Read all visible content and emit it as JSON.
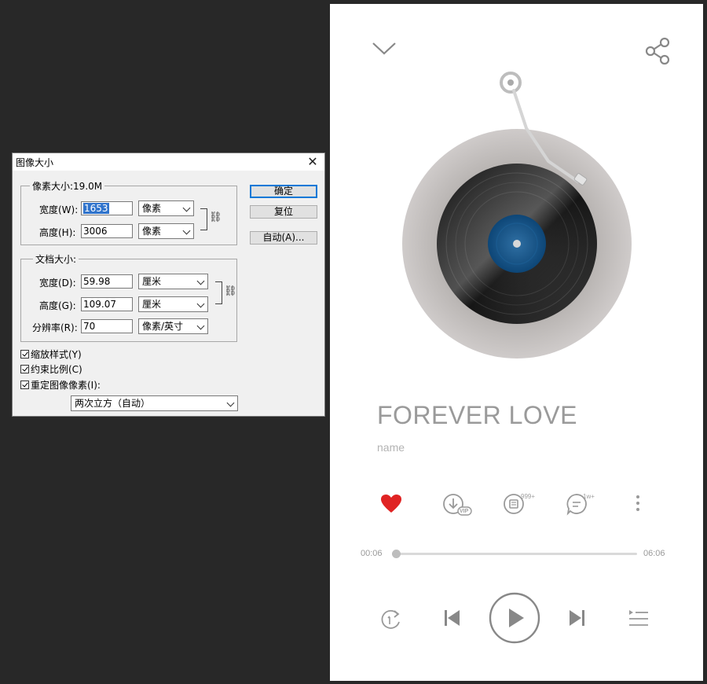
{
  "dialog": {
    "title": "图像大小",
    "pixel_dimensions": {
      "label": "像素大小:19.0M",
      "width_label": "宽度(W):",
      "width_value": "1653",
      "width_unit": "像素",
      "height_label": "高度(H):",
      "height_value": "3006",
      "height_unit": "像素"
    },
    "document_size": {
      "label": "文档大小:",
      "width_label": "宽度(D):",
      "width_value": "59.98",
      "width_unit": "厘米",
      "height_label": "高度(G):",
      "height_value": "109.07",
      "height_unit": "厘米",
      "resolution_label": "分辨率(R):",
      "resolution_value": "70",
      "resolution_unit": "像素/英寸"
    },
    "buttons": {
      "ok": "确定",
      "reset": "复位",
      "auto": "自动(A)..."
    },
    "checkboxes": [
      {
        "label": "缩放样式(Y)",
        "checked": true
      },
      {
        "label": "约束比例(C)",
        "checked": true
      },
      {
        "label": "重定图像像素(I):",
        "checked": true
      }
    ],
    "resample_method": "两次立方（自动）"
  },
  "player": {
    "song_title": "FOREVER LOVE",
    "artist": "name",
    "actions": {
      "favorite_color": "#e02323",
      "download_badge": "VIP",
      "effects_badge": "999+",
      "comments_badge": "1w+"
    },
    "progress": {
      "elapsed": "00:06",
      "total": "06:06",
      "fraction": 0.016
    },
    "icons": [
      "collapse-chevron-icon",
      "share-icon",
      "heart-icon",
      "download-icon",
      "sound-effect-icon",
      "comment-icon",
      "more-icon",
      "repeat-one-icon",
      "previous-icon",
      "play-icon",
      "next-icon",
      "playlist-icon"
    ]
  }
}
